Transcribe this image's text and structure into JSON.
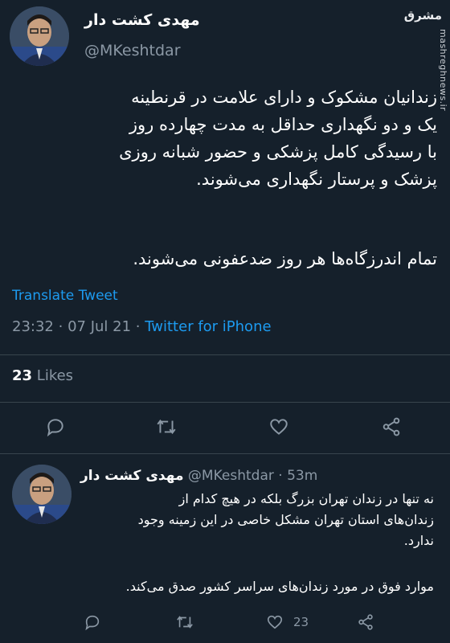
{
  "watermark": {
    "logo_text": "مشرق",
    "side_text": "mashreghnews.ir"
  },
  "main_tweet": {
    "author_name": "مهدی کشت دار",
    "handle": "@MKeshtdar",
    "body_lines": [
      "زندانیان مشکوک و دارای علامت در قرنطینه",
      "یک و دو نگهداری حداقل به مدت چهارده روز",
      "با رسیدگی کامل پزشکی و حضور شبانه روزی",
      "پزشک و پرستار نگهداری می‌شوند."
    ],
    "body_line2": "تمام اندرزگاه‌ها هر روز ضدعفونی می‌شوند.",
    "translate_label": "Translate Tweet",
    "time": "23:32",
    "separator": "·",
    "date": "07 Jul 21",
    "source": "Twitter for iPhone",
    "likes_count": "23",
    "likes_label": "Likes"
  },
  "reply_tweet": {
    "author_name": "مهدی کشت دار",
    "handle": "@MKeshtdar",
    "separator": "·",
    "age": "53m",
    "body_lines": [
      "نه تنها در زندان تهران بزرگ بلکه در هیچ کدام از",
      "زندان‌های استان تهران مشکل خاصی در این زمینه وجود",
      "ندارد."
    ],
    "body_line2": "موارد فوق در مورد زندان‌های سراسر کشور صدق می‌کند.",
    "like_count": "23"
  },
  "colors": {
    "background": "#15202b",
    "accent": "#1d9bf0",
    "muted": "#8b98a5",
    "divider": "#38444d"
  }
}
